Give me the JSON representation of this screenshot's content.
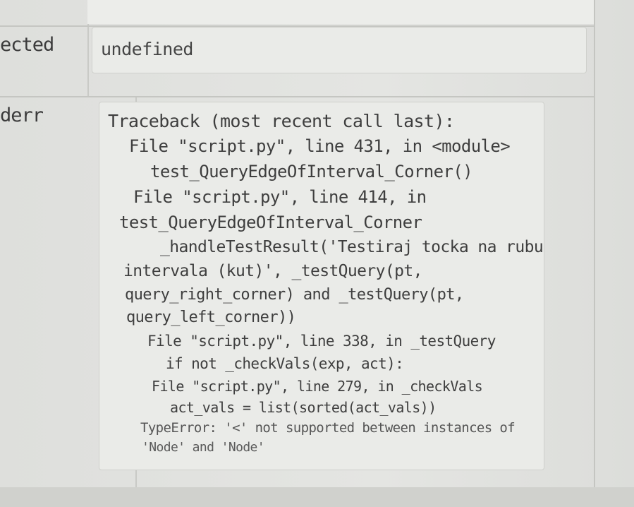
{
  "rows": {
    "expected": {
      "label": "ected",
      "value": "undefined"
    },
    "stderr": {
      "label": "derr",
      "lines": [
        "Traceback (most recent call last):",
        "File \"script.py\", line 431, in <module>",
        "test_QueryEdgeOfInterval_Corner()",
        "File \"script.py\", line 414, in",
        "test_QueryEdgeOfInterval_Corner",
        "_handleTestResult('Testiraj tocka na rubu",
        "intervala (kut)', _testQuery(pt,",
        "query_right_corner) and _testQuery(pt,",
        "query_left_corner))",
        "File \"script.py\", line 338, in _testQuery",
        "if not _checkVals(exp, act):",
        "File \"script.py\", line 279, in _checkVals",
        "act_vals = list(sorted(act_vals))",
        "TypeError: '<' not supported between instances of",
        "'Node' and 'Node'"
      ]
    }
  }
}
